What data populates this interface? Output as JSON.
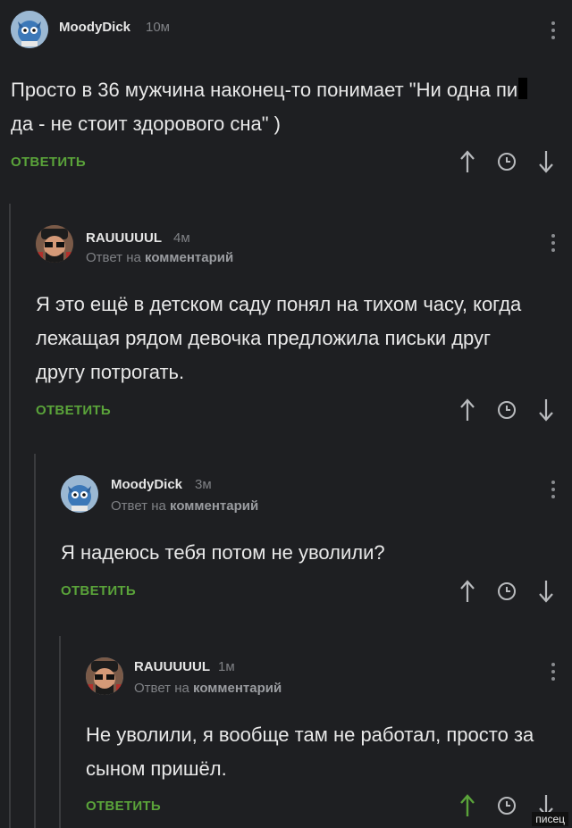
{
  "comments": [
    {
      "author": "MoodyDick",
      "time": "10м",
      "reply_prefix": "",
      "reply_target": "",
      "text_before": "Просто в 36 мужчина наконец-то понимает \"Ни одна пи",
      "text_after": "да - не стоит здорового сна\" )",
      "reply_label": "ОТВЕТИТЬ",
      "avatar_icon": "blue-character-avatar"
    },
    {
      "author": "RAUUUUUL",
      "time": "4м",
      "reply_prefix": "Ответ на ",
      "reply_target": "комментарий",
      "text": "Я это ещё в детском саду понял на тихом часу, когда лежащая рядом девочка предложила письки друг другу потрогать.",
      "reply_label": "ОТВЕТИТЬ",
      "avatar_icon": "man-with-sunglasses-avatar"
    },
    {
      "author": "MoodyDick",
      "time": "3м",
      "reply_prefix": "Ответ на ",
      "reply_target": "комментарий",
      "text": "Я надеюсь тебя потом не уволили?",
      "reply_label": "ОТВЕТИТЬ",
      "avatar_icon": "blue-character-avatar"
    },
    {
      "author": "RAUUUUUL",
      "time": "1м",
      "reply_prefix": "Ответ на ",
      "reply_target": "комментарий",
      "text": "Не уволили, я вообще там не работал, просто за сыном пришёл.",
      "reply_label": "ОТВЕТИТЬ",
      "avatar_icon": "man-with-sunglasses-avatar"
    }
  ],
  "colors": {
    "background": "#1e1f22",
    "accent_green": "#5aa33a",
    "upvoted_green": "#5aa33a",
    "muted": "#7f8185"
  },
  "watermark": "писец"
}
